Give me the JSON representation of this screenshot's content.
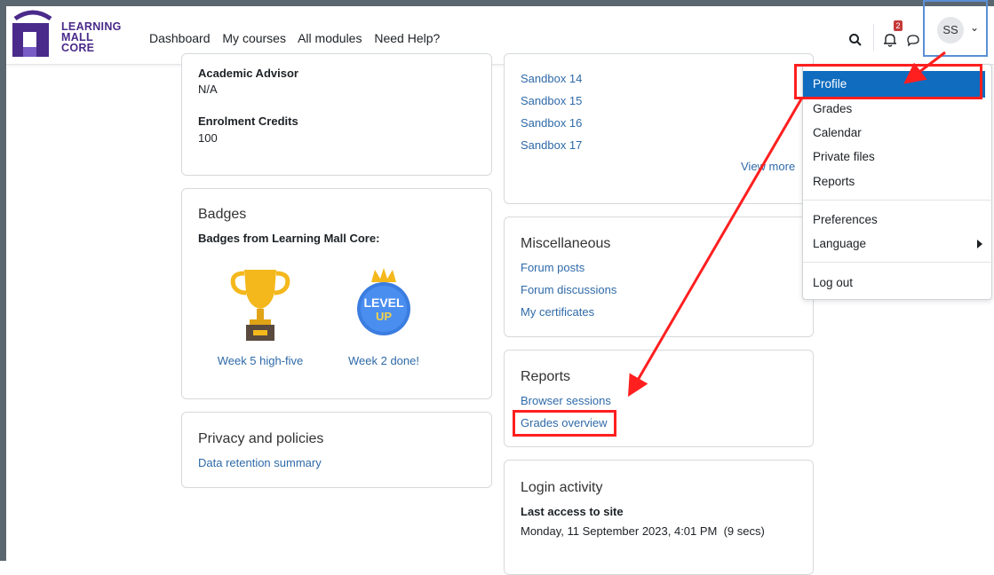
{
  "colors": {
    "accent": "#0f6cbf",
    "link": "#2f6aa8",
    "annotation": "#ff1f1f"
  },
  "logo": {
    "line1": "LEARNING",
    "line2": "MALL",
    "line3": "CORE"
  },
  "nav": {
    "links": [
      "Dashboard",
      "My courses",
      "All modules",
      "Need Help?"
    ]
  },
  "header": {
    "notification_count": "2",
    "avatar_initials": "SS"
  },
  "user_menu": {
    "items": [
      "Profile",
      "Grades",
      "Calendar",
      "Private files",
      "Reports",
      "Preferences",
      "Language",
      "Log out"
    ]
  },
  "details": {
    "advisor_label": "Academic Advisor",
    "advisor_value": "N/A",
    "credits_label": "Enrolment Credits",
    "credits_value": "100"
  },
  "badges_card": {
    "title": "Badges",
    "subtitle": "Badges from Learning Mall Core:",
    "items": [
      "Week 5 high-five",
      "Week 2 done!"
    ],
    "level_up_line1": "LEVEL",
    "level_up_line2": "UP"
  },
  "privacy_card": {
    "title": "Privacy and policies",
    "link": "Data retention summary"
  },
  "courses_card": {
    "links": [
      "Sandbox 14",
      "Sandbox 15",
      "Sandbox 16",
      "Sandbox 17"
    ],
    "view_more": "View more"
  },
  "misc_card": {
    "title": "Miscellaneous",
    "links": [
      "Forum posts",
      "Forum discussions",
      "My certificates"
    ]
  },
  "reports_card": {
    "title": "Reports",
    "links": [
      "Browser sessions",
      "Grades overview"
    ]
  },
  "login_card": {
    "title": "Login activity",
    "label": "Last access to site",
    "value": "Monday, 11 September 2023, 4:01 PM  (9 secs)"
  }
}
